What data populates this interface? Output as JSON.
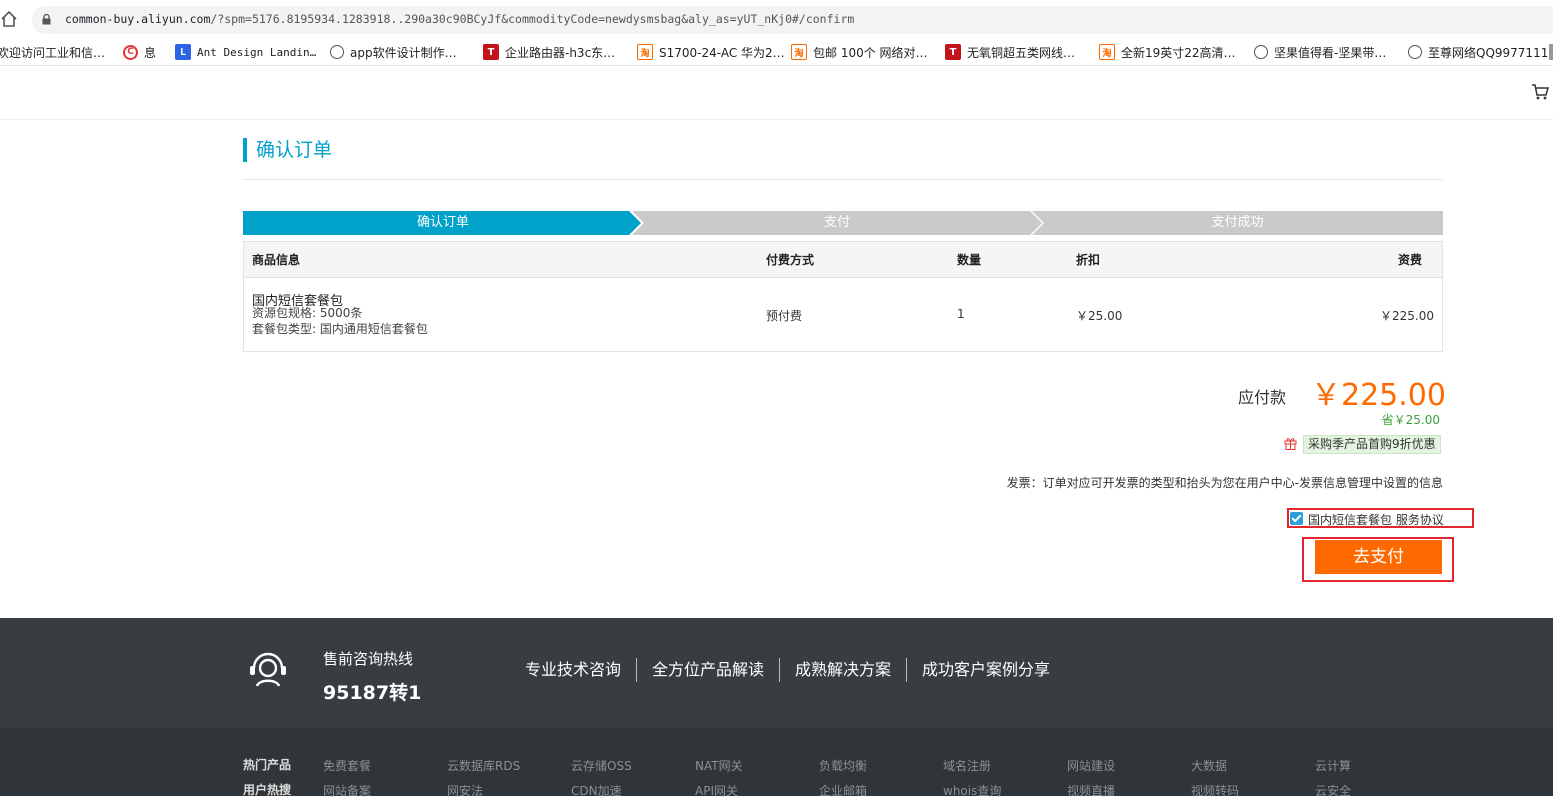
{
  "browser": {
    "url_prefix": "common-buy.aliyun.com",
    "url_rest": "/?spm=5176.8195934.1283918..290a30c90BCyJf&commodityCode=newdysmsbag&aly_as=yUT_nKj0#/confirm",
    "bookmarks": [
      {
        "icon": "none",
        "label": "欢迎访问工业和信…"
      },
      {
        "icon": "c-circle-icon",
        "label": "息"
      },
      {
        "icon": "l-square-icon",
        "label": "Ant Design Landin…"
      },
      {
        "icon": "globe-icon",
        "label": "app软件设计制作…"
      },
      {
        "icon": "t-square-icon",
        "label": "企业路由器-h3c东…"
      },
      {
        "icon": "taobao-icon",
        "label": "S1700-24-AC 华为2…"
      },
      {
        "icon": "taobao-icon",
        "label": "包邮 100个 网络对…"
      },
      {
        "icon": "t-square-icon",
        "label": "无氧铜超五类网线…"
      },
      {
        "icon": "taobao-icon",
        "label": "全新19英寸22高清…"
      },
      {
        "icon": "globe-icon",
        "label": "坚果值得看-坚果带…"
      },
      {
        "icon": "globe-icon",
        "label": "至尊网络QQ9977111"
      }
    ]
  },
  "page": {
    "title": "确认订单",
    "steps": [
      "确认订单",
      "支付",
      "支付成功"
    ],
    "active_step": 0
  },
  "order_table": {
    "headers": [
      "商品信息",
      "付费方式",
      "数量",
      "折扣",
      "资费"
    ],
    "row": {
      "product_name": "国内短信套餐包",
      "spec1": "资源包规格: 5000条",
      "spec2": "套餐包类型: 国内通用短信套餐包",
      "payment_type": "预付费",
      "quantity": "1",
      "discount": "￥25.00",
      "price": "￥225.00"
    }
  },
  "summary": {
    "pay_label": "应付款",
    "pay_amount": "￥225.00",
    "save_text": "省￥25.00",
    "promo_tag": "采购季产品首购9折优惠",
    "invoice_text": "发票：订单对应可开发票的类型和抬头为您在用户中心-发票信息管理中设置的信息",
    "agreement_checked": true,
    "agreement_text": "国内短信套餐包 服务协议",
    "pay_button": "去支付"
  },
  "footer": {
    "hotline_label": "售前咨询热线",
    "hotline_number": "95187转1",
    "links": [
      "专业技术咨询",
      "全方位产品解读",
      "成熟解决方案",
      "成功客户案例分享"
    ],
    "rows": [
      {
        "head": "热门产品",
        "items": [
          "免费套餐",
          "云数据库RDS",
          "云存储OSS",
          "NAT网关",
          "负载均衡",
          "域名注册",
          "网站建设",
          "大数据",
          "云计算"
        ]
      },
      {
        "head": "用户热搜",
        "items": [
          "网站备案",
          "网安法",
          "CDN加速",
          "API网关",
          "企业邮箱",
          "whois查询",
          "视频直播",
          "视频转码",
          "云安全"
        ]
      }
    ]
  },
  "colors": {
    "accent": "#00a2ca",
    "pay_orange": "#ff6a00",
    "highlight_red": "#e3262d",
    "footer_dark": "#373d41"
  }
}
